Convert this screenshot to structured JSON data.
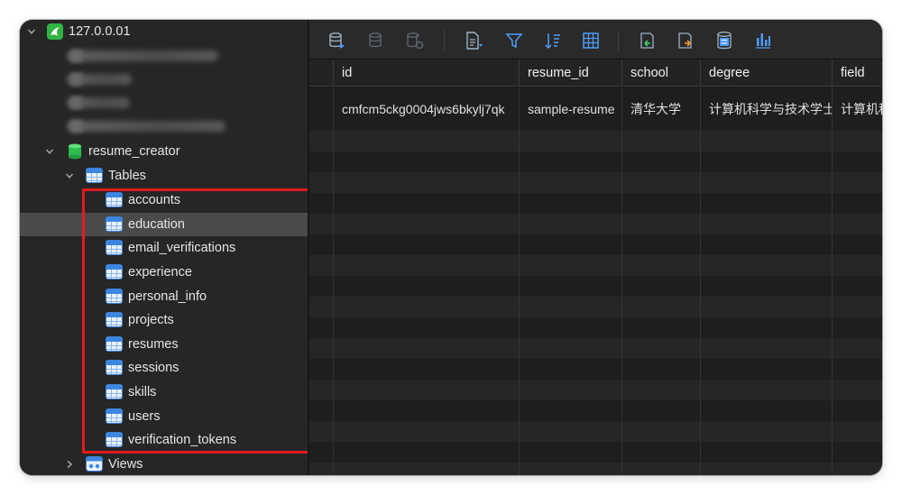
{
  "sidebar": {
    "connection": {
      "label": "127.0.0.01",
      "icon": "mysql-dolphin-icon"
    },
    "database": {
      "label": "resume_creator",
      "icon": "database-cylinder-icon"
    },
    "tables_group": {
      "label": "Tables"
    },
    "tables": [
      {
        "label": "accounts"
      },
      {
        "label": "education",
        "selected": true
      },
      {
        "label": "email_verifications"
      },
      {
        "label": "experience"
      },
      {
        "label": "personal_info"
      },
      {
        "label": "projects"
      },
      {
        "label": "resumes"
      },
      {
        "label": "sessions"
      },
      {
        "label": "skills"
      },
      {
        "label": "users"
      },
      {
        "label": "verification_tokens"
      }
    ],
    "views_group": {
      "label": "Views"
    }
  },
  "grid": {
    "columns": [
      "id",
      "resume_id",
      "school",
      "degree",
      "field"
    ],
    "rows": [
      [
        "cmfcm5ckg0004jws6bkylj7qk",
        "sample-resume",
        "清华大学",
        "计算机科学与技术学士",
        "计算机科"
      ]
    ]
  },
  "colors": {
    "highlight_box": "#e31b1b",
    "selected_row": "#4a4a4a",
    "accent_blue": "#3d86e0",
    "db_green": "#34c759"
  }
}
